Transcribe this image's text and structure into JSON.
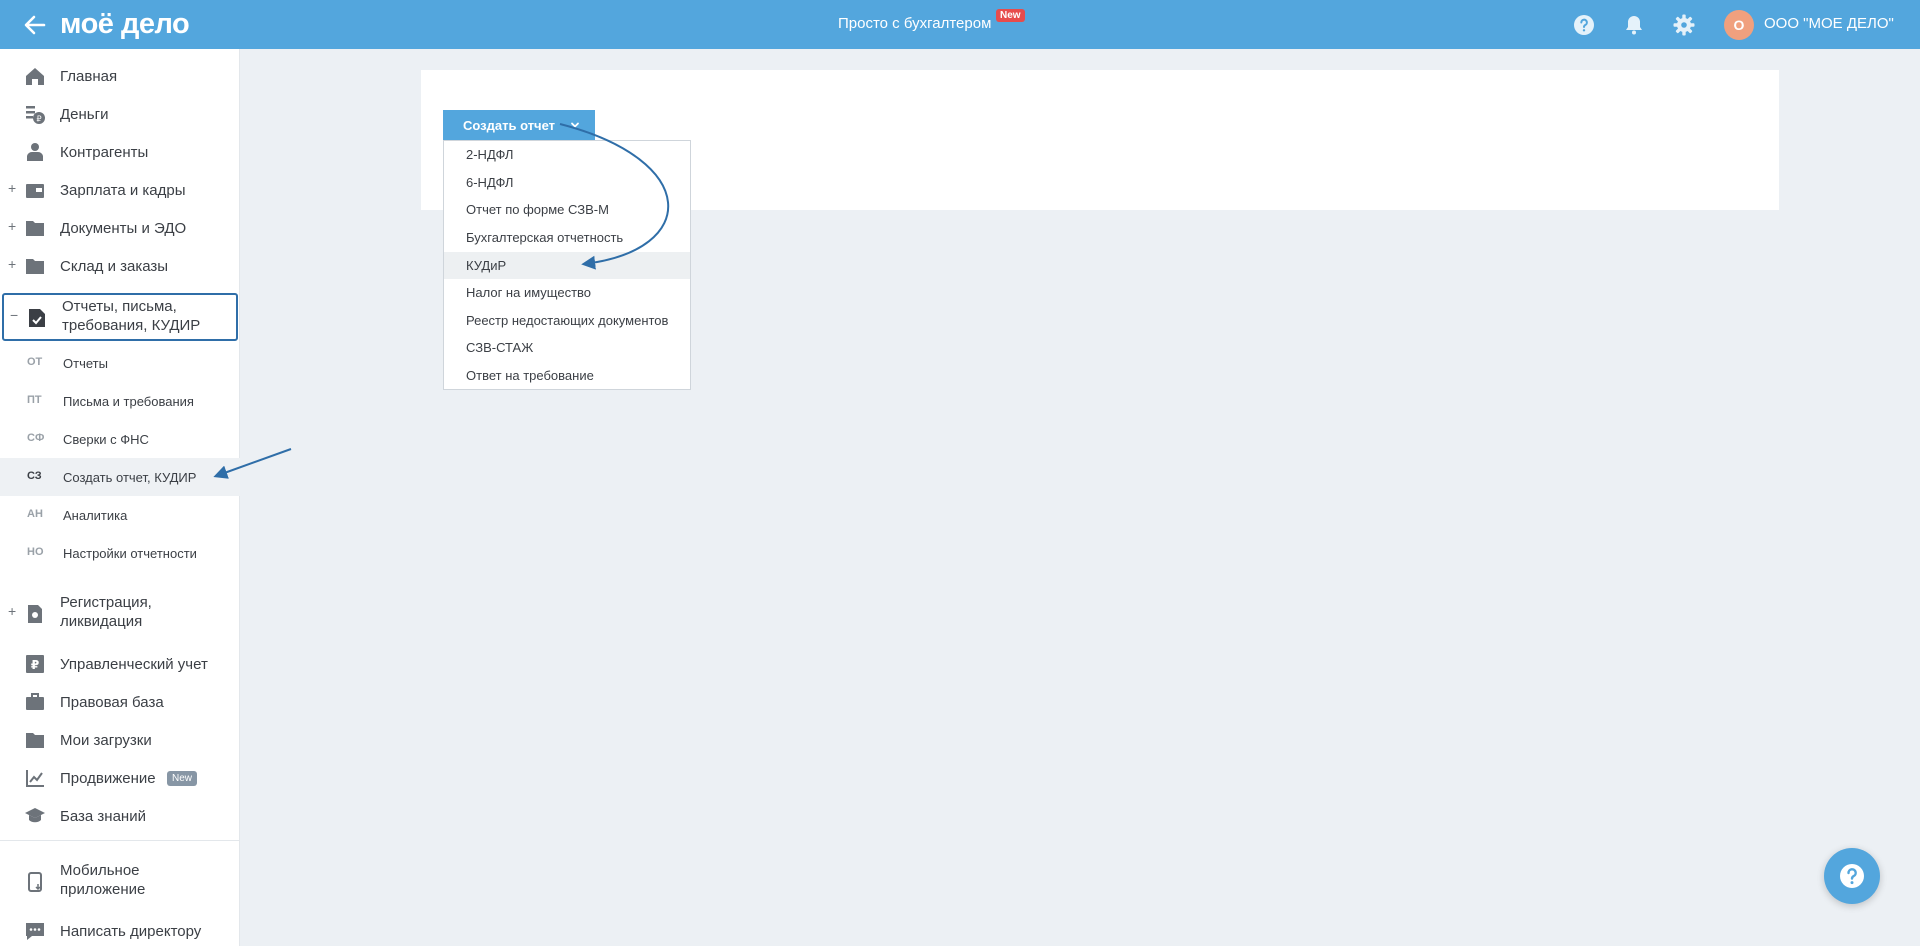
{
  "header": {
    "logo": "моё дело",
    "center_title": "Просто с бухгалтером",
    "new_badge": "New",
    "avatar_letter": "О",
    "company": "ООО \"МОЕ ДЕЛО\""
  },
  "sidebar": {
    "items": [
      {
        "label": "Главная"
      },
      {
        "label": "Деньги"
      },
      {
        "label": "Контрагенты"
      },
      {
        "label": "Зарплата и кадры"
      },
      {
        "label": "Документы и ЭДО"
      },
      {
        "label": "Склад и заказы"
      },
      {
        "label": "Отчеты, письма, требования, КУДИР"
      }
    ],
    "expand_plus": "+",
    "collapse_minus": "−",
    "sub_items": [
      {
        "abbr": "ОТ",
        "label": "Отчеты"
      },
      {
        "abbr": "ПТ",
        "label": "Письма и требования"
      },
      {
        "abbr": "СФ",
        "label": "Сверки с ФНС"
      },
      {
        "abbr": "СЗ",
        "label": "Создать отчет, КУДИР"
      },
      {
        "abbr": "АН",
        "label": "Аналитика"
      },
      {
        "abbr": "НО",
        "label": "Настройки отчетности"
      }
    ],
    "lower_items": [
      {
        "label": "Регистрация, ликвидация"
      },
      {
        "label": "Управленческий учет"
      },
      {
        "label": "Правовая база"
      },
      {
        "label": "Мои загрузки"
      },
      {
        "label": "Продвижение"
      },
      {
        "label": "База знаний"
      }
    ],
    "promo_badge": "New",
    "bottom_items": [
      {
        "label": "Мобильное приложение"
      },
      {
        "label": "Написать директору"
      }
    ]
  },
  "main": {
    "create_button": "Создать отчет",
    "dropdown": [
      "2-НДФЛ",
      "6-НДФЛ",
      "Отчет по форме СЗВ-М",
      "Бухгалтерская отчетность",
      "КУДиР",
      "Налог на имущество",
      "Реестр недостающих документов",
      "СЗВ-СТАЖ",
      "Ответ на требование"
    ]
  },
  "colors": {
    "header_bg": "#53a6dd",
    "accent": "#53a6dd",
    "annotation": "#2f6ea8",
    "badge_red": "#e74c4c",
    "avatar": "#f0a07e"
  }
}
